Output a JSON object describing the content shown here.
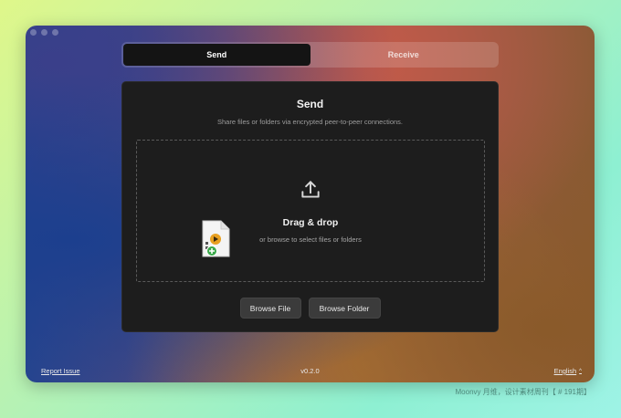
{
  "tabs": [
    {
      "label": "Send",
      "active": true
    },
    {
      "label": "Receive",
      "active": false
    }
  ],
  "card": {
    "title": "Send",
    "subtitle": "Share files or folders via encrypted peer-to-peer connections."
  },
  "dropzone": {
    "icon": "upload-icon",
    "title": "Drag & drop",
    "subtitle": "or browse to select files or folders",
    "drag_file_icon": "media-file-add-icon"
  },
  "buttons": {
    "browse_file": "Browse File",
    "browse_folder": "Browse Folder"
  },
  "footer": {
    "report_issue": "Report Issue",
    "version": "v0.2.0",
    "language": "English",
    "language_caret": "^"
  },
  "credit": "Moonvy 月维，设计素材周刊【 # 191期】",
  "colors": {
    "card_bg": "#1d1d1d",
    "active_tab_bg": "#141414",
    "button_bg": "#3b3b3b"
  }
}
